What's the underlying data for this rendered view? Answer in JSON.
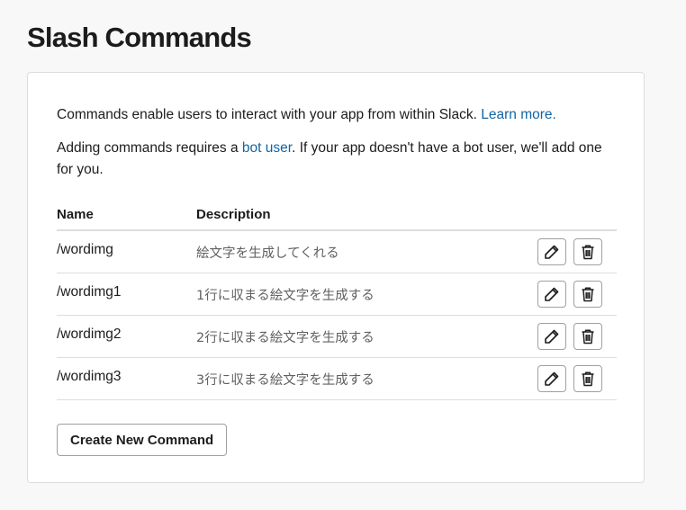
{
  "page": {
    "title": "Slash Commands"
  },
  "intro": {
    "line1_text": "Commands enable users to interact with your app from within Slack. ",
    "line1_link": "Learn more.",
    "line2_prefix": "Adding commands requires a ",
    "line2_link": "bot user",
    "line2_suffix": ". If your app doesn't have a bot user, we'll add one for you."
  },
  "table": {
    "headers": {
      "name": "Name",
      "description": "Description"
    },
    "rows": [
      {
        "name": "/wordimg",
        "description": "絵文字を生成してくれる",
        "edit_icon": "pencil-icon",
        "delete_icon": "trash-icon"
      },
      {
        "name": "/wordimg1",
        "description": "1行に収まる絵文字を生成する",
        "edit_icon": "pencil-icon",
        "delete_icon": "trash-icon"
      },
      {
        "name": "/wordimg2",
        "description": "2行に収まる絵文字を生成する",
        "edit_icon": "pencil-icon",
        "delete_icon": "trash-icon"
      },
      {
        "name": "/wordimg3",
        "description": "3行に収まる絵文字を生成する",
        "edit_icon": "pencil-icon",
        "delete_icon": "trash-icon"
      }
    ]
  },
  "actions": {
    "create_label": "Create New Command"
  },
  "colors": {
    "link": "#1264a3",
    "background": "#f8f8f8",
    "card": "#ffffff",
    "border": "#dddddd"
  }
}
